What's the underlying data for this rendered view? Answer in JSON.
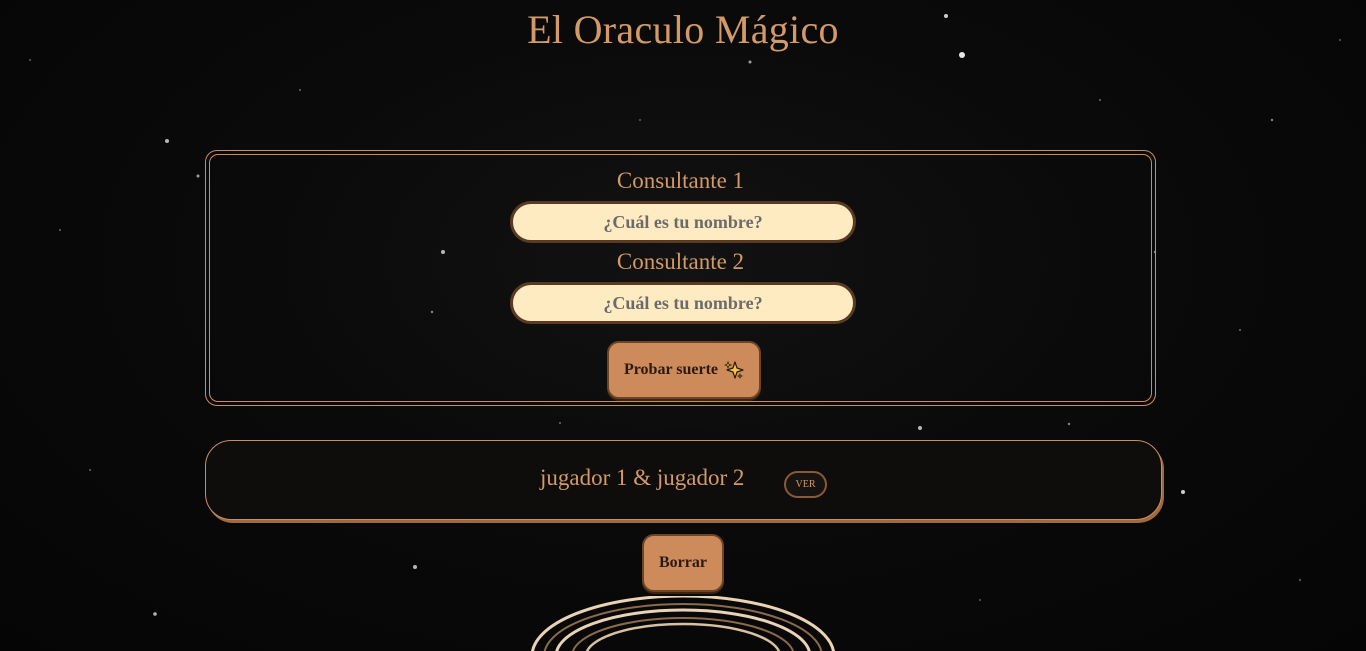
{
  "header": {
    "title": "El Oraculo Mágico"
  },
  "form": {
    "player1": {
      "label": "Consultante 1",
      "placeholder": "¿Cuál es tu nombre?",
      "value": ""
    },
    "player2": {
      "label": "Consultante 2",
      "placeholder": "¿Cuál es tu nombre?",
      "value": ""
    },
    "submit_label": "Probar suerte",
    "submit_icon": "sparkles-icon"
  },
  "result": {
    "pair_text": "jugador 1 & jugador 2",
    "view_label": "VER"
  },
  "actions": {
    "delete_label": "Borrar"
  },
  "colors": {
    "background": "#070707",
    "accent": "#d39a68",
    "button": "#cd8b5b",
    "input_bg": "#ffebc2"
  }
}
